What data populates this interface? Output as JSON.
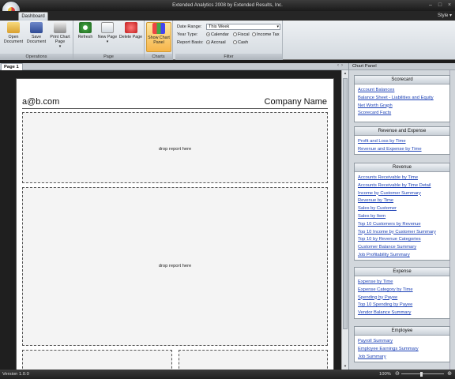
{
  "window": {
    "title": "Extended Analytics 2008 by Extended Results, Inc."
  },
  "tabs": {
    "dashboard": "Dashboard",
    "style": "Style"
  },
  "ribbon": {
    "open_label": "Open Document",
    "save_label": "Save Document",
    "print_label": "Print Chart Page",
    "operations_label": "Operations",
    "refresh_label": "Refresh",
    "new_page_label": "New Page",
    "delete_page_label": "Delete Page",
    "page_group_label": "Page",
    "show_chart_panel_label": "Show Chart Panel",
    "charts_group_label": "Charts",
    "filter_group_label": "Filter",
    "date_range_label": "Date Range:",
    "date_range_value": "This Week",
    "year_type_label": "Year Type:",
    "year_calendar": "Calendar",
    "year_fiscal": "Fiscal",
    "year_income_tax": "Income Tax",
    "report_basis_label": "Report Basis:",
    "basis_accrual": "Accrual",
    "basis_cash": "Cash"
  },
  "page": {
    "tab_label": "Page 1",
    "email": "a@b.com",
    "company": "Company Name",
    "drop_text_1": "drop report here",
    "drop_text_2": "drop report here"
  },
  "chart_panel": {
    "title": "Chart Panel",
    "sections": [
      {
        "title": "Scorecard",
        "links": [
          "Account Balances",
          "Balance Sheet - Liabilities and Equity",
          "Net Worth Graph",
          "Scorecard Facts"
        ]
      },
      {
        "title": "Revenue and Expense",
        "links": [
          "Profit and Loss by Time",
          "Revenue and Expense by Time"
        ]
      },
      {
        "title": "Revenue",
        "links": [
          "Accounts Receivable by Time",
          "Accounts Receivable by Time Detail",
          "Income by Customer Summary",
          "Revenue by Time",
          "Sales by Customer",
          "Sales by Item",
          "Top 10 Customers by Revenue",
          "Top 10 Income by Customer Summary",
          "Top 10 by Revenue Categories",
          "Customer Balance Summary",
          "Job Profitability Summary"
        ]
      },
      {
        "title": "Expense",
        "links": [
          "Expense by Time",
          "Expense Category by Time",
          "Spending by Payee",
          "Top 10 Spending by Payee",
          "Vendor Balance Summary"
        ]
      },
      {
        "title": "Employee",
        "links": [
          "Payroll Summary",
          "Employee Earnings Summary",
          "Job Summary"
        ]
      }
    ]
  },
  "status": {
    "version": "Version 1.0.0",
    "zoom": "100%"
  }
}
